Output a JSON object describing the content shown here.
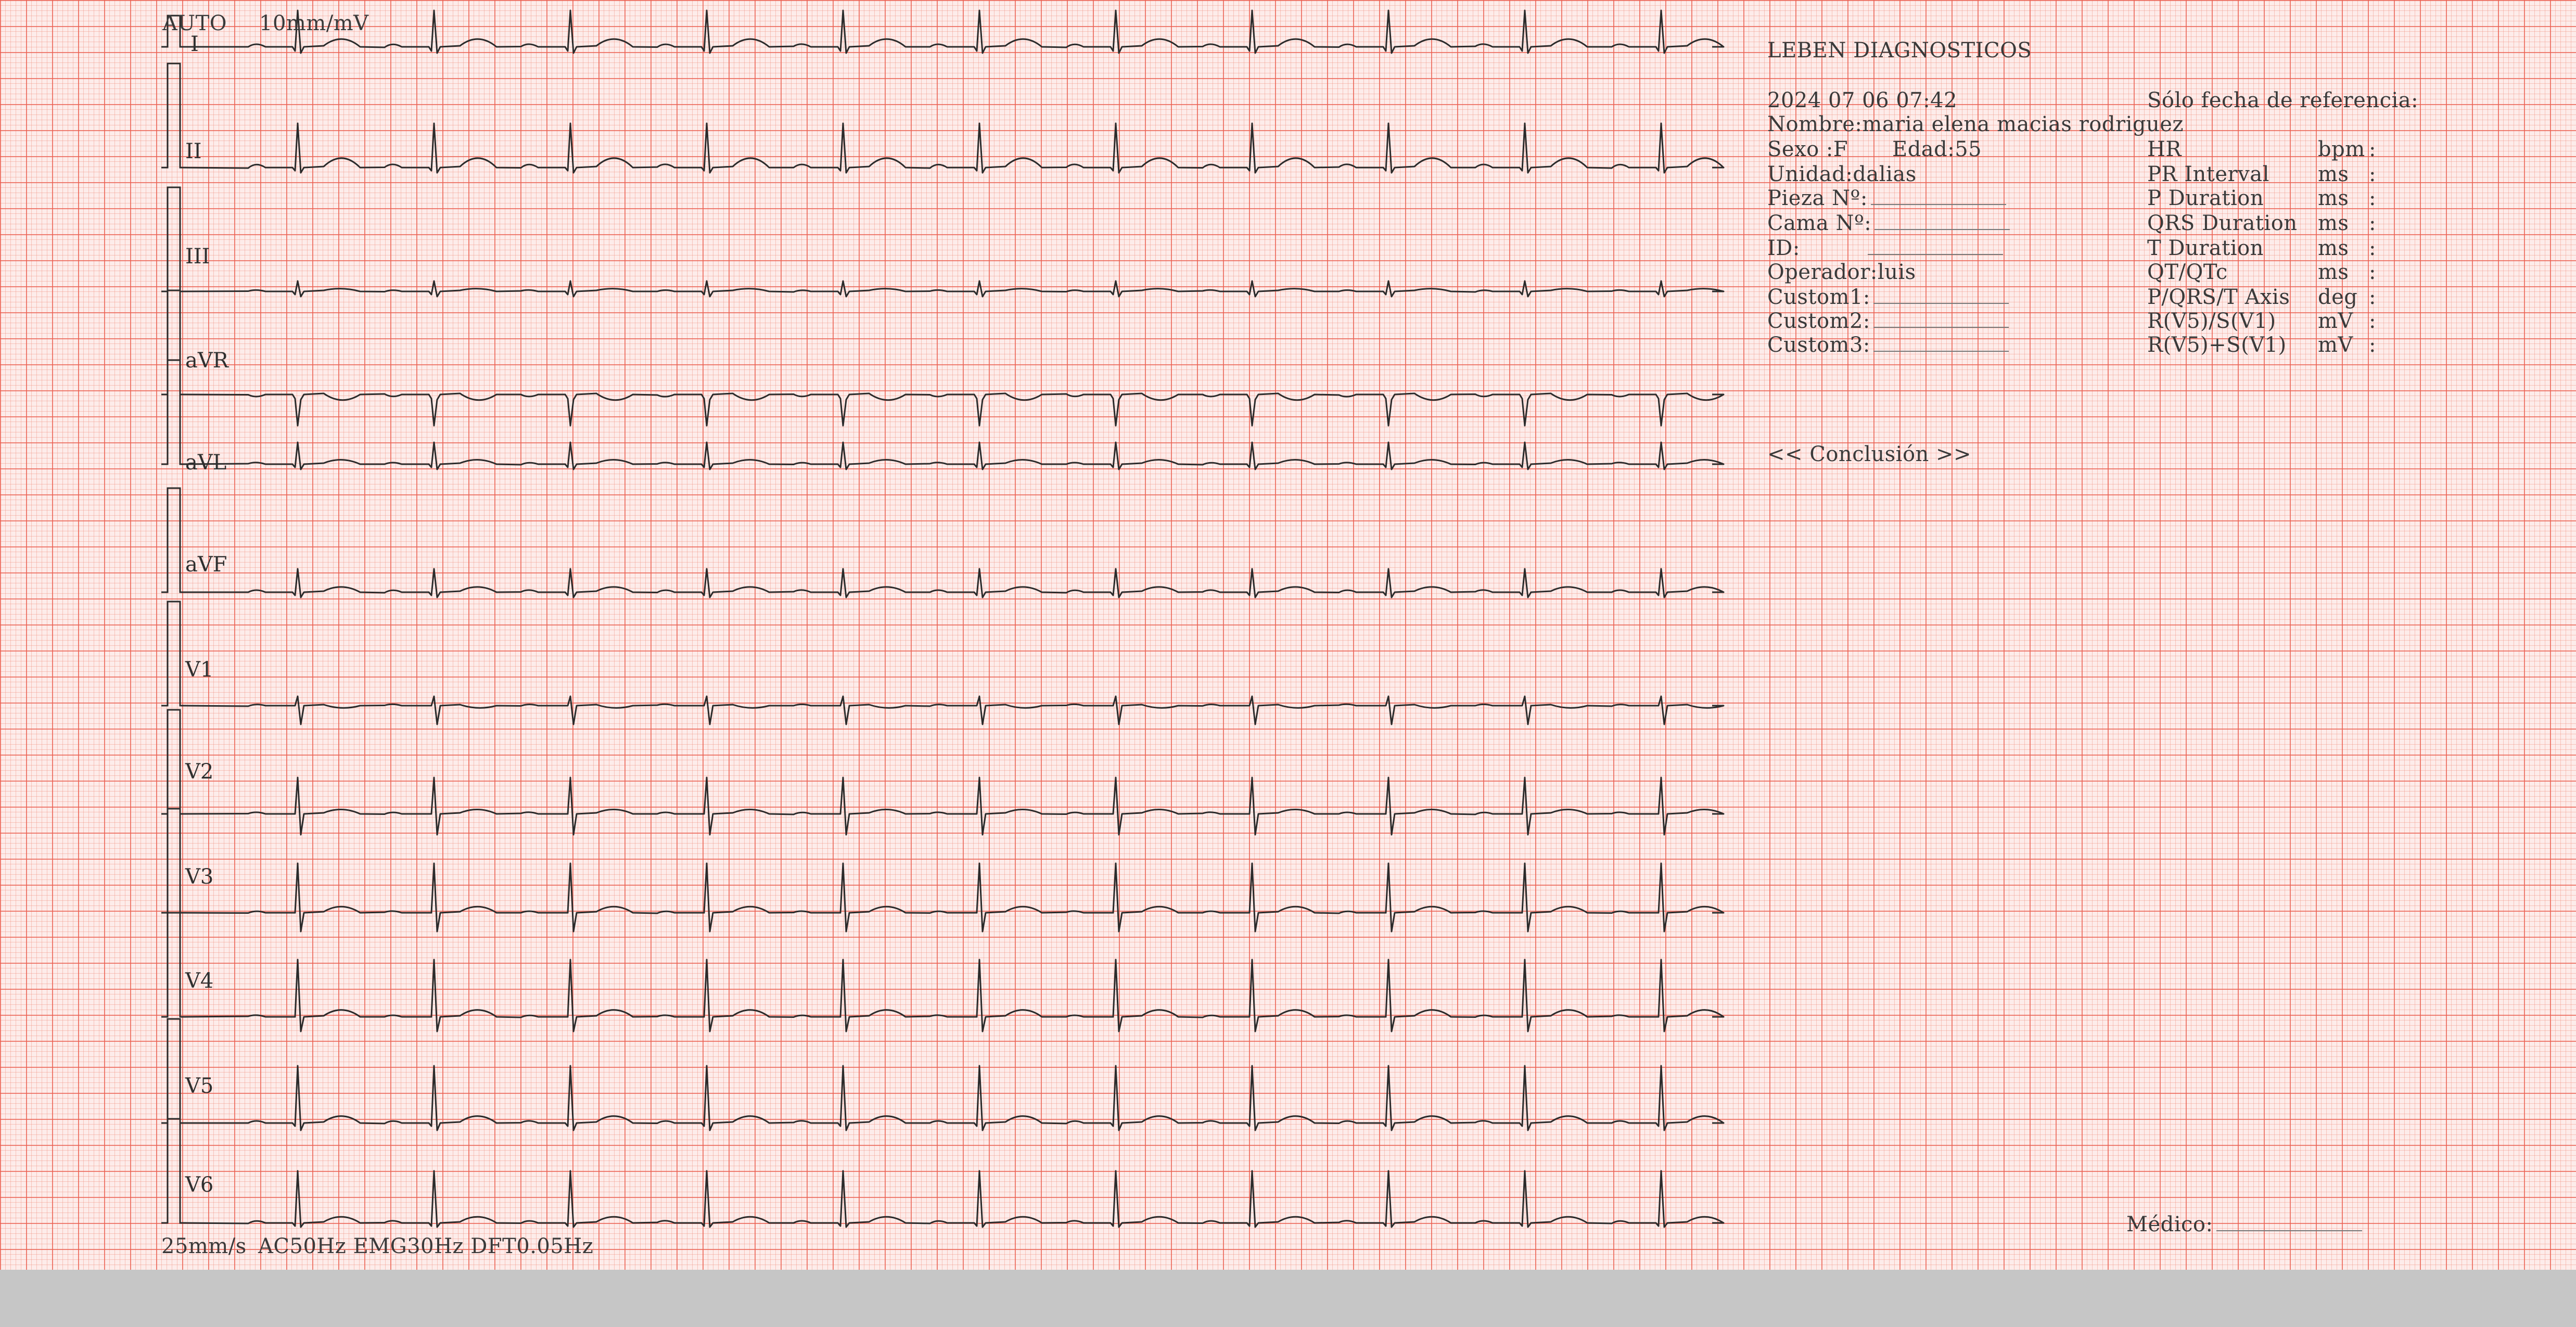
{
  "header": {
    "mode": "AUTO",
    "gain": "10mm/mV"
  },
  "leads": [
    "I",
    "II",
    "III",
    "aVR",
    "aVL",
    "aVF",
    "V1",
    "V2",
    "V3",
    "V4",
    "V5",
    "V6"
  ],
  "footer": {
    "speed": "25mm/s",
    "filters": "AC50Hz EMG30Hz DFT0.05Hz"
  },
  "report": {
    "institution": "LEBEN DIAGNOSTICOS",
    "datetime": "2024 07 06 07:42",
    "reference_note": "Sólo fecha de referencia:",
    "patient": {
      "nombre": "Nombre:maria elena macias rodriguez",
      "sexo": "Sexo  :F",
      "edad": "Edad:55",
      "unidad": "Unidad:dalias",
      "pieza": "Pieza Nº:",
      "cama": "Cama Nº:",
      "id": "ID:",
      "operador": "Operador:luis",
      "custom1": "Custom1:",
      "custom2": "Custom2:",
      "custom3": "Custom3:"
    },
    "measurements": [
      {
        "label": "HR",
        "unit": "bpm",
        "sep": ":"
      },
      {
        "label": "PR Interval",
        "unit": "ms",
        "sep": ":"
      },
      {
        "label": "P Duration",
        "unit": "ms",
        "sep": ":"
      },
      {
        "label": "QRS Duration",
        "unit": "ms",
        "sep": ":"
      },
      {
        "label": "T Duration",
        "unit": "ms",
        "sep": ":"
      },
      {
        "label": "QT/QTc",
        "unit": "ms",
        "sep": ":"
      },
      {
        "label": "P/QRS/T Axis",
        "unit": "deg",
        "sep": ":"
      },
      {
        "label": "R(V5)/S(V1)",
        "unit": "mV",
        "sep": ":"
      },
      {
        "label": "R(V5)+S(V1)",
        "unit": "mV",
        "sep": ":"
      }
    ],
    "conclusion": "<< Conclusión >>",
    "medico": "Médico:"
  }
}
